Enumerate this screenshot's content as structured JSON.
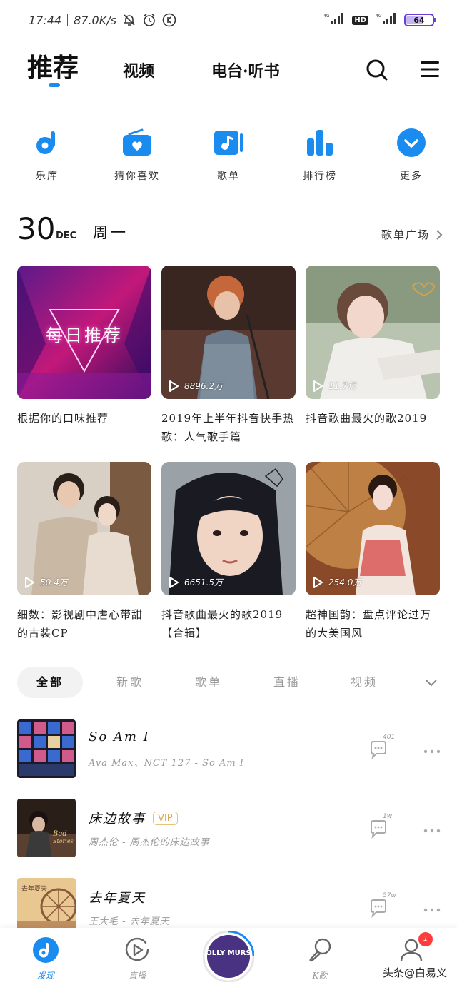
{
  "status_bar": {
    "time": "17:44",
    "speed": "87.0K/s",
    "hd": "HD",
    "battery": "64"
  },
  "top_nav": {
    "tabs": [
      "推荐",
      "视频",
      "电台·听书"
    ],
    "active_tab": "推荐"
  },
  "quick_entries": [
    {
      "label": "乐库",
      "icon": "music-note-icon"
    },
    {
      "label": "猜你喜欢",
      "icon": "radio-heart-icon"
    },
    {
      "label": "歌单",
      "icon": "playlist-icon"
    },
    {
      "label": "排行榜",
      "icon": "chart-bars-icon"
    },
    {
      "label": "更多",
      "icon": "chevron-down-circle-icon"
    }
  ],
  "date": {
    "day": "30",
    "month": "DEC",
    "weekday": "周一",
    "plaza_link": "歌单广场"
  },
  "playlists": [
    {
      "title": "根据你的口味推荐",
      "cover_text": "每日推荐",
      "play_count": ""
    },
    {
      "title": "2019年上半年抖音快手热歌：人气歌手篇",
      "play_count": "8896.2万"
    },
    {
      "title": "抖音歌曲最火的歌2019",
      "play_count": "11.7亿"
    },
    {
      "title": "细数：影视剧中虐心带甜的古装CP",
      "play_count": "50.4万"
    },
    {
      "title": "抖音歌曲最火的歌2019【合辑】",
      "play_count": "6651.5万"
    },
    {
      "title": "超神国韵：盘点评论过万的大美国风",
      "play_count": "254.0万"
    }
  ],
  "filter_tabs": [
    "全部",
    "新歌",
    "歌单",
    "直播",
    "视频"
  ],
  "songs": [
    {
      "title": "So Am I",
      "subtitle": "Ava Max、NCT 127 - So Am I",
      "comments": "401",
      "vip": ""
    },
    {
      "title": "床边故事",
      "subtitle": "周杰伦 - 周杰伦的床边故事",
      "comments": "1w",
      "vip": "VIP"
    },
    {
      "title": "去年夏天",
      "subtitle": "王大毛 - 去年夏天",
      "comments": "57w",
      "vip": ""
    }
  ],
  "bottom_nav": {
    "items": [
      "发现",
      "直播",
      "K歌",
      ""
    ],
    "center_cover_text": "OLLY MURS",
    "badge": "1"
  },
  "watermark": "头条@白易义",
  "colors": {
    "accent": "#1a8cf0",
    "text": "#111111",
    "muted": "#999999"
  }
}
